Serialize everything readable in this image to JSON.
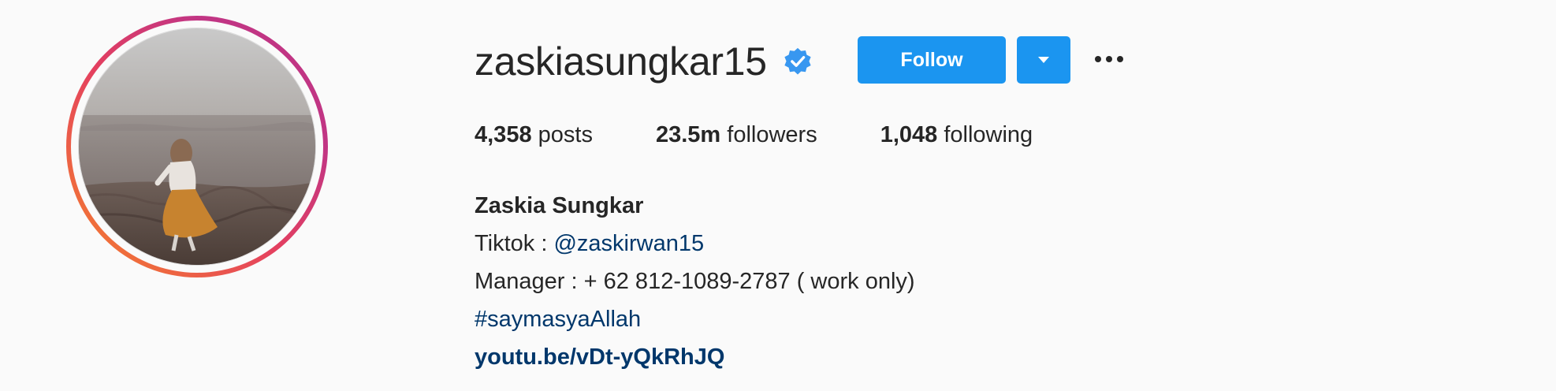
{
  "profile": {
    "username": "zaskiasungkar15",
    "verified": true,
    "follow_label": "Follow",
    "stats": {
      "posts_count": "4,358",
      "posts_label": "posts",
      "followers_count": "23.5m",
      "followers_label": "followers",
      "following_count": "1,048",
      "following_label": "following"
    },
    "bio": {
      "full_name": "Zaskia Sungkar",
      "tiktok_prefix": "Tiktok : ",
      "tiktok_handle": "@zaskirwan15",
      "manager_line": "Manager : + 62 812-1089-2787 ( work only)",
      "hashtag": "#saymasyaAllah",
      "website": "youtu.be/vDt-yQkRhJQ"
    }
  },
  "icons": {
    "verified": "verified-badge-icon",
    "dropdown": "caret-down-icon",
    "more": "more-options-icon"
  },
  "colors": {
    "primary_button": "#1b95f0",
    "link": "#00376b",
    "text": "#262626",
    "background": "#fafafa"
  }
}
